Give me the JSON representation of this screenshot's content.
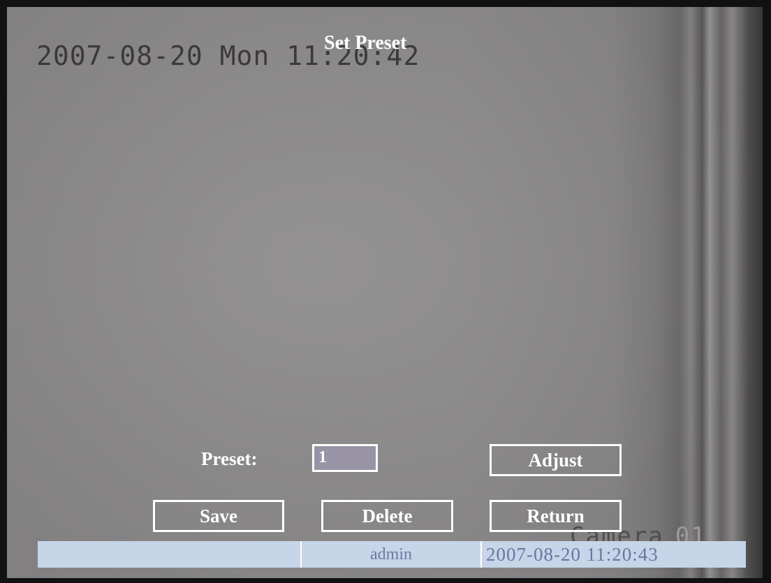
{
  "overlay": {
    "clock": "2007-08-20 Mon 11:20:42",
    "camera_label": "Camera",
    "camera_number": "01"
  },
  "dialog": {
    "title": "Set Preset",
    "preset_label": "Preset:",
    "preset_value": "1",
    "adjust_label": "Adjust",
    "save_label": "Save",
    "delete_label": "Delete",
    "return_label": "Return"
  },
  "status_bar": {
    "left": "",
    "user": "admin",
    "datetime": "2007-08-20 11:20:43"
  },
  "colors": {
    "osd_text": "#ffffff",
    "status_bar_bg": "#c6d5e8",
    "status_bar_text": "#6e7aa3",
    "input_bg": "#9893a5"
  }
}
